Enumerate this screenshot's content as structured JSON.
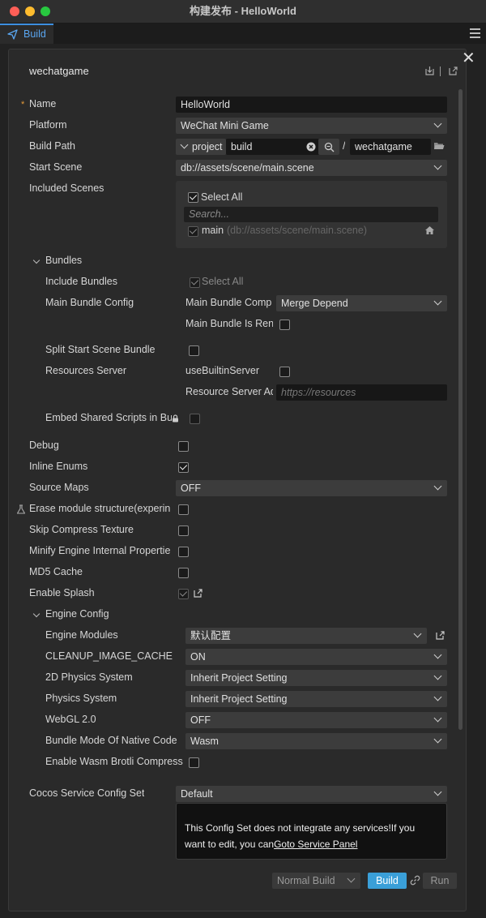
{
  "window": {
    "title": "构建发布 - HelloWorld"
  },
  "tabs": [
    {
      "label": "Build"
    }
  ],
  "panel": {
    "platform_header": "wechatgame",
    "close_glyph": "✕"
  },
  "form": {
    "name_label": "Name",
    "name_value": "HelloWorld",
    "platform_label": "Platform",
    "platform_value": "WeChat Mini Game",
    "build_path_label": "Build Path",
    "build_path_prefix": "project",
    "build_path_value": "build",
    "build_path_sep": "/",
    "build_path_folder": "wechatgame",
    "start_scene_label": "Start Scene",
    "start_scene_value": "db://assets/scene/main.scene",
    "included_scenes_label": "Included Scenes",
    "select_all": "Select All",
    "search_placeholder": "Search...",
    "scene_item_name": "main",
    "scene_item_path": "(db://assets/scene/main.scene)"
  },
  "bundles": {
    "section_label": "Bundles",
    "include_bundles_label": "Include Bundles",
    "include_bundles_value": "Select All",
    "main_bundle_config_label": "Main Bundle Config",
    "main_bundle_comp_label": "Main Bundle Comp",
    "main_bundle_comp_value": "Merge Depend",
    "main_bundle_remote_label": "Main Bundle Is Ren",
    "split_start_scene_label": "Split Start Scene Bundle",
    "resources_server_label": "Resources Server",
    "use_builtin_label": "useBuiltinServer",
    "resource_server_addr_label": "Resource Server Ad",
    "resource_server_placeholder": "https://resources",
    "embed_shared_scripts_label": "Embed Shared Scripts in Bu"
  },
  "options": {
    "debug_label": "Debug",
    "inline_enums_label": "Inline Enums",
    "source_maps_label": "Source Maps",
    "source_maps_value": "OFF",
    "erase_module_label": "Erase module structure(experin",
    "skip_compress_label": "Skip Compress Texture",
    "minify_label": "Minify Engine Internal Propertie",
    "md5_label": "MD5 Cache",
    "splash_label": "Enable Splash"
  },
  "engine": {
    "section_label": "Engine Config",
    "modules_label": "Engine Modules",
    "modules_value": "默认配置",
    "cleanup_label": "CLEANUP_IMAGE_CACHE",
    "cleanup_value": "ON",
    "physics2d_label": "2D Physics System",
    "physics2d_value": "Inherit Project Setting",
    "physics_label": "Physics System",
    "physics_value": "Inherit Project Setting",
    "webgl2_label": "WebGL 2.0",
    "webgl2_value": "OFF",
    "bundle_mode_label": "Bundle Mode Of Native Code",
    "bundle_mode_value": "Wasm",
    "wasm_brotli_label": "Enable Wasm Brotli Compress"
  },
  "service": {
    "label": "Cocos Service Config Set",
    "value": "Default",
    "info_text": "This Config Set does not integrate any services!If you want to edit, you can",
    "info_link": "Goto Service Panel"
  },
  "footer": {
    "build_mode": "Normal Build",
    "build_button": "Build",
    "run_button": "Run"
  }
}
